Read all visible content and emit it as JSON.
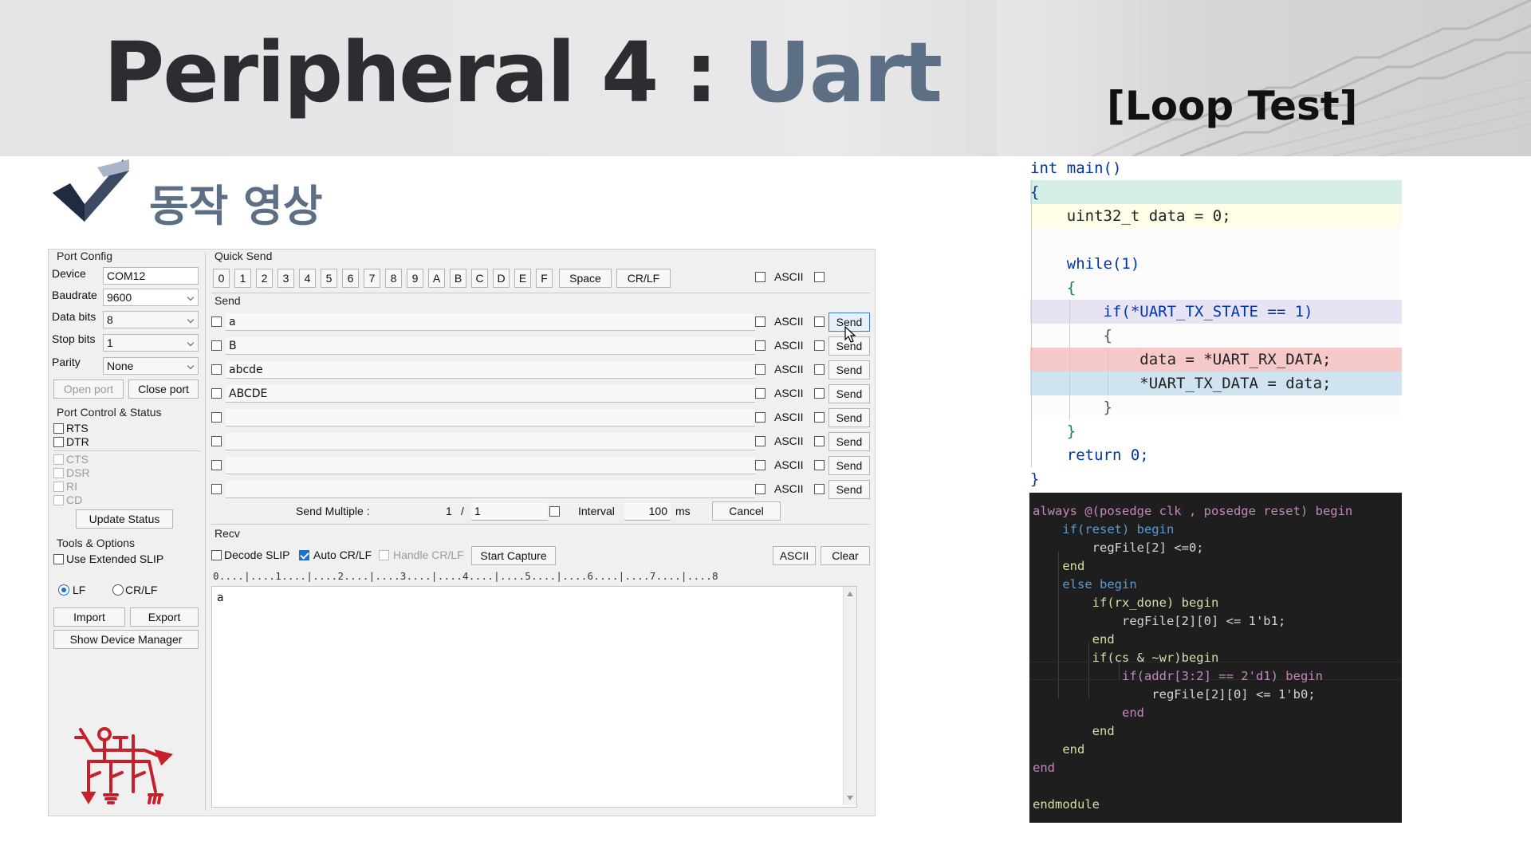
{
  "slide": {
    "title_main": "Peripheral  4 : ",
    "title_accent": "Uart",
    "subtitle": "[Loop Test]",
    "section_label": "동작 영상"
  },
  "terminal": {
    "port_config": {
      "group_label": "Port Config",
      "device_label": "Device",
      "device_value": "COM12",
      "baudrate_label": "Baudrate",
      "baudrate_value": "9600",
      "databits_label": "Data bits",
      "databits_value": "8",
      "stopbits_label": "Stop bits",
      "stopbits_value": "1",
      "parity_label": "Parity",
      "parity_value": "None",
      "open_port": "Open port",
      "close_port": "Close port"
    },
    "port_control": {
      "group_label": "Port Control & Status",
      "rts": "RTS",
      "dtr": "DTR",
      "cts": "CTS",
      "dsr": "DSR",
      "ri": "RI",
      "cd": "CD",
      "update_status": "Update Status"
    },
    "tools": {
      "group_label": "Tools & Options",
      "extended_slip": "Use Extended SLIP",
      "lf": "LF",
      "crlf": "CR/LF",
      "import": "Import",
      "export": "Export",
      "device_manager": "Show Device Manager"
    },
    "quick_send": {
      "group_label": "Quick Send",
      "keys": [
        "0",
        "1",
        "2",
        "3",
        "4",
        "5",
        "6",
        "7",
        "8",
        "9",
        "A",
        "B",
        "C",
        "D",
        "E",
        "F"
      ],
      "space": "Space",
      "crlf": "CR/LF",
      "ascii": "ASCII"
    },
    "send": {
      "group_label": "Send",
      "rows": [
        {
          "text": "a",
          "ascii": "ASCII",
          "button": "Send"
        },
        {
          "text": "B",
          "ascii": "ASCII",
          "button": "Send"
        },
        {
          "text": "abcde",
          "ascii": "ASCII",
          "button": "Send"
        },
        {
          "text": "ABCDE",
          "ascii": "ASCII",
          "button": "Send"
        },
        {
          "text": "",
          "ascii": "ASCII",
          "button": "Send"
        },
        {
          "text": "",
          "ascii": "ASCII",
          "button": "Send"
        },
        {
          "text": "",
          "ascii": "ASCII",
          "button": "Send"
        },
        {
          "text": "",
          "ascii": "ASCII",
          "button": "Send"
        }
      ],
      "send_multiple_label": "Send Multiple :",
      "multiple_count": "1",
      "slash": "/",
      "multiple_value": "1",
      "interval_label": "Interval",
      "interval_value": "100",
      "interval_unit": "ms",
      "cancel": "Cancel"
    },
    "recv": {
      "group_label": "Recv",
      "decode_slip": "Decode SLIP",
      "auto_crlf": "Auto CR/LF",
      "handle_crlf": "Handle CR/LF",
      "start_capture": "Start Capture",
      "ascii": "ASCII",
      "clear": "Clear",
      "ruler": "0....|....1....|....2....|....3....|....4....|....5....|....6....|....7....|....8",
      "content": "a"
    }
  },
  "c_code": {
    "lines": [
      "int main()",
      "{",
      "    uint32_t data = 0;",
      "",
      "    while(1)",
      "    {",
      "        if(*UART_TX_STATE == 1)",
      "        {",
      "            data = *UART_RX_DATA;",
      "            *UART_TX_DATA = data;",
      "        }",
      "    }",
      "    return 0;",
      "}"
    ],
    "highlight_colors": {
      "open_brace": "#d6efe6",
      "declaration": "#fdfde8",
      "if_line": "#e6e4f3",
      "rx_line": "#f6c9c9",
      "tx_line": "#cfe3f1"
    }
  },
  "verilog_code": {
    "lines": [
      "always @(posedge clk , posedge reset) begin",
      "    if(reset) begin",
      "        regFile[2] <=0;",
      "    end",
      "    else begin",
      "        if(rx_done) begin",
      "            regFile[2][0] <= 1'b1;",
      "        end",
      "        if(cs & ~wr)begin",
      "            if(addr[3:2] == 2'd1) begin",
      "                regFile[2][0] <= 1'b0;",
      "            end",
      "        end",
      "    end",
      "end",
      "",
      "endmodule"
    ]
  },
  "colors": {
    "title_dark": "#2b2d33",
    "title_accent": "#5d6f85",
    "logo_red": "#c8202a",
    "editor_bg": "#1e1e1e"
  }
}
